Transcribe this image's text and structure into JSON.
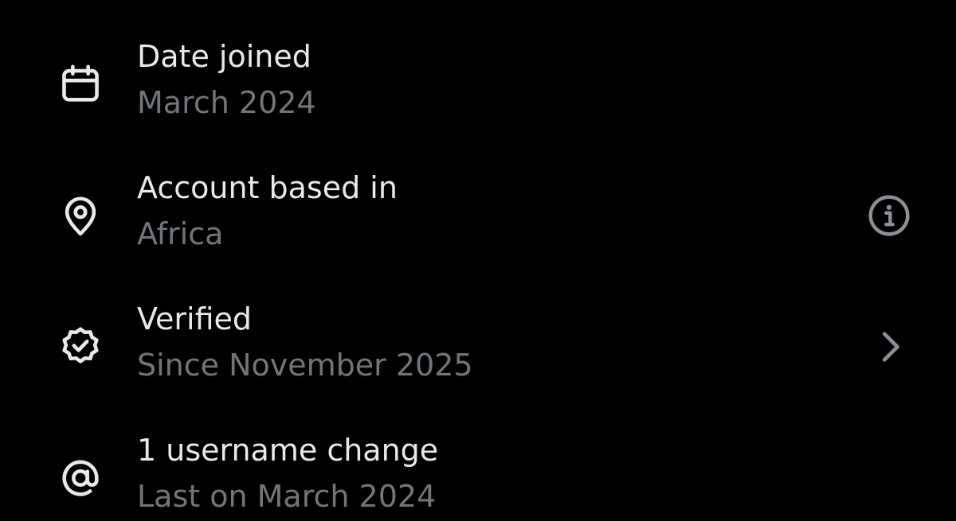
{
  "colors": {
    "background": "#000000",
    "primary_text": "#e8e9ea",
    "secondary_text": "#71767b",
    "icon": "#e8e9ea",
    "muted_icon": "#8b9096"
  },
  "items": [
    {
      "icon": "calendar-icon",
      "title": "Date joined",
      "subtitle": "March 2024",
      "trailing": null
    },
    {
      "icon": "location-pin-icon",
      "title": "Account based in",
      "subtitle": "Africa",
      "trailing": "info-icon"
    },
    {
      "icon": "verified-badge-icon",
      "title": "Verified",
      "subtitle": "Since November 2025",
      "trailing": "chevron-right-icon"
    },
    {
      "icon": "at-sign-icon",
      "title": "1 username change",
      "subtitle": "Last on March 2024",
      "trailing": null
    }
  ]
}
